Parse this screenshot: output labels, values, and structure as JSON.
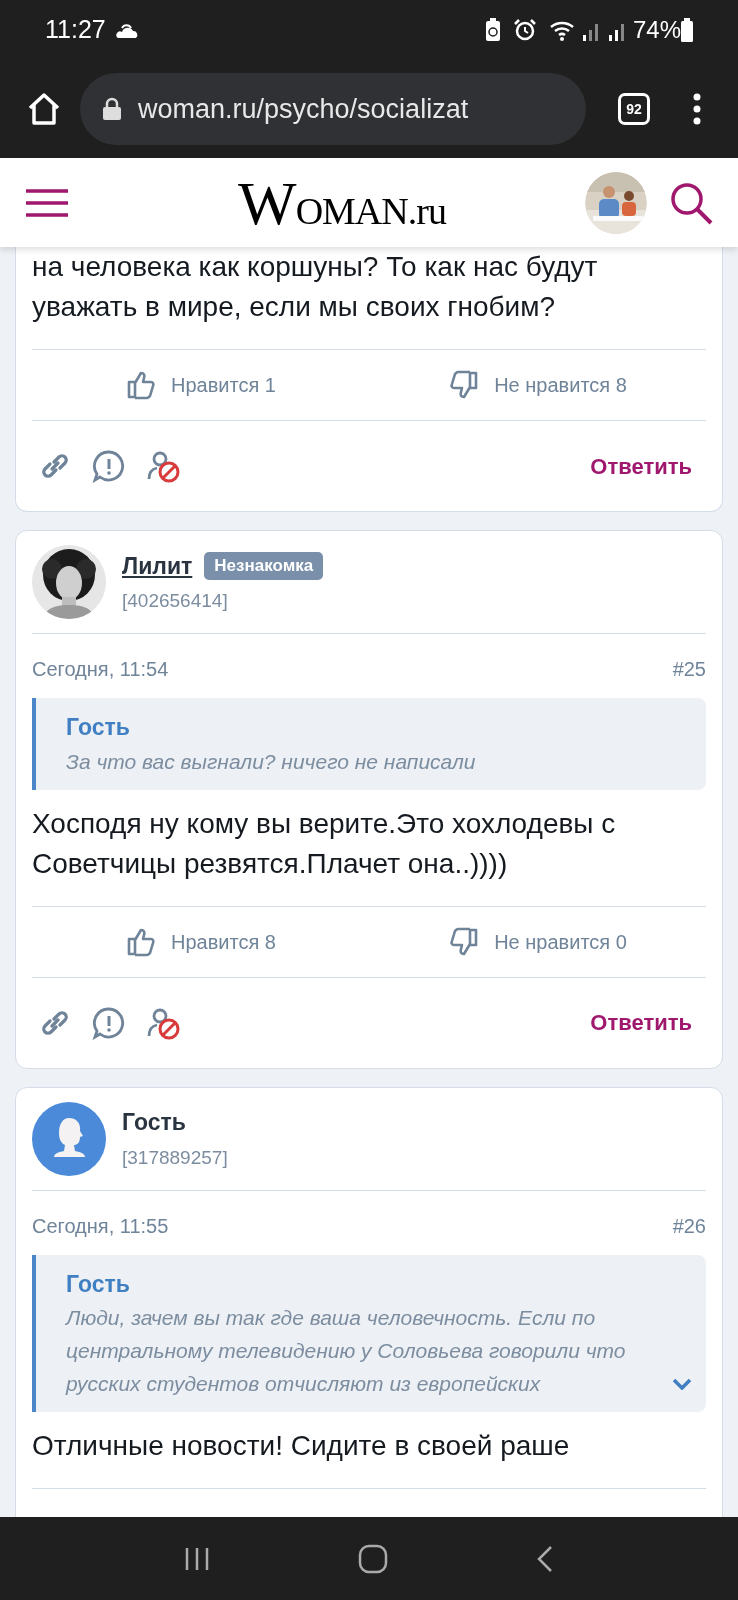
{
  "status_bar": {
    "time": "11:27",
    "battery": "74%"
  },
  "browser": {
    "url": "woman.ru/psycho/socializat",
    "tab_count": "92"
  },
  "site_header": {
    "logo": "WOMAN.ru"
  },
  "posts": [
    {
      "text": "на человека как коршуны? То как нас будут уважать в мире, если мы своих гнобим?",
      "likes": "Нравится 1",
      "dislikes": "Не нравится 8",
      "reply": "Ответить"
    },
    {
      "author": {
        "kind": "member",
        "name": "Лилит",
        "badge": "Незнакомка",
        "user_id": "[402656414]"
      },
      "date": "Сегодня, 11:54",
      "number": "#25",
      "quote": {
        "author": "Гость",
        "text": "За что вас выгнали? ничего не написали",
        "expandable": false
      },
      "text": "Хосподя ну кому вы верите.Это хохлодевы с Советчицы резвятся.Плачет она..))))",
      "likes": "Нравится 8",
      "dislikes": "Не нравится 0",
      "reply": "Ответить"
    },
    {
      "author": {
        "kind": "guest",
        "name": "Гость",
        "user_id": "[317889257]"
      },
      "date": "Сегодня, 11:55",
      "number": "#26",
      "quote": {
        "author": "Гость",
        "text": "Люди, зачем вы так где ваша человечность. Если по центральному телевидению у Соловьева говорили что русских студентов отчисляют из европейских",
        "expandable": true
      },
      "text": "Отличные новости! Сидите в своей раше"
    }
  ]
}
